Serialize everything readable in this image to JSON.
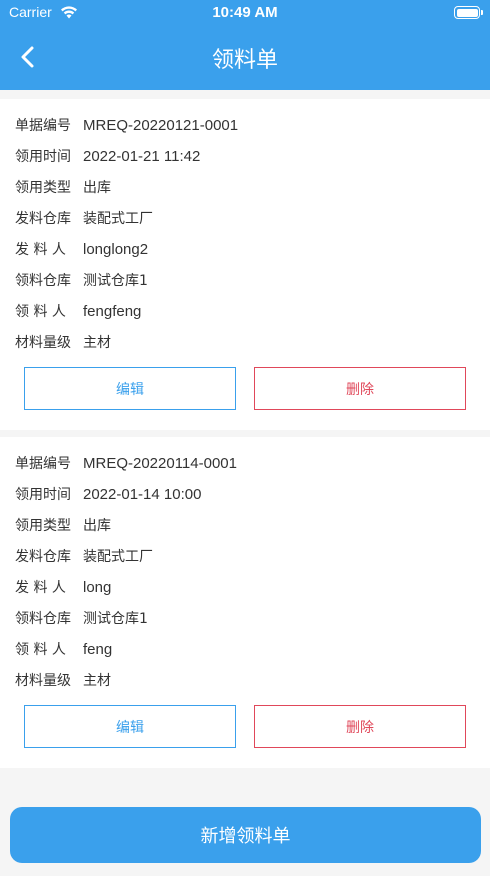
{
  "status_bar": {
    "carrier": "Carrier",
    "time": "10:49 AM"
  },
  "nav": {
    "title": "领料单"
  },
  "cards": [
    {
      "rows": [
        {
          "label": "单据编号",
          "value": "MREQ-20220121-0001"
        },
        {
          "label": "领用时间",
          "value": "2022-01-21 11:42"
        },
        {
          "label": "领用类型",
          "value": "出库"
        },
        {
          "label": "发料仓库",
          "value": "装配式工厂"
        },
        {
          "label": "发 料 人",
          "value": "longlong2"
        },
        {
          "label": "领料仓库",
          "value": "测试仓库1"
        },
        {
          "label": "领 料 人",
          "value": "fengfeng"
        },
        {
          "label": "材料量级",
          "value": "主材"
        }
      ],
      "edit_label": "编辑",
      "delete_label": "删除"
    },
    {
      "rows": [
        {
          "label": "单据编号",
          "value": "MREQ-20220114-0001"
        },
        {
          "label": "领用时间",
          "value": "2022-01-14 10:00"
        },
        {
          "label": "领用类型",
          "value": "出库"
        },
        {
          "label": "发料仓库",
          "value": "装配式工厂"
        },
        {
          "label": "发 料 人",
          "value": "long"
        },
        {
          "label": "领料仓库",
          "value": "测试仓库1"
        },
        {
          "label": "领 料 人",
          "value": "feng"
        },
        {
          "label": "材料量级",
          "value": "主材"
        }
      ],
      "edit_label": "编辑",
      "delete_label": "删除"
    }
  ],
  "footer": {
    "add_label": "新增领料单"
  },
  "colors": {
    "primary": "#3aa0ec",
    "danger": "#e0485a"
  }
}
